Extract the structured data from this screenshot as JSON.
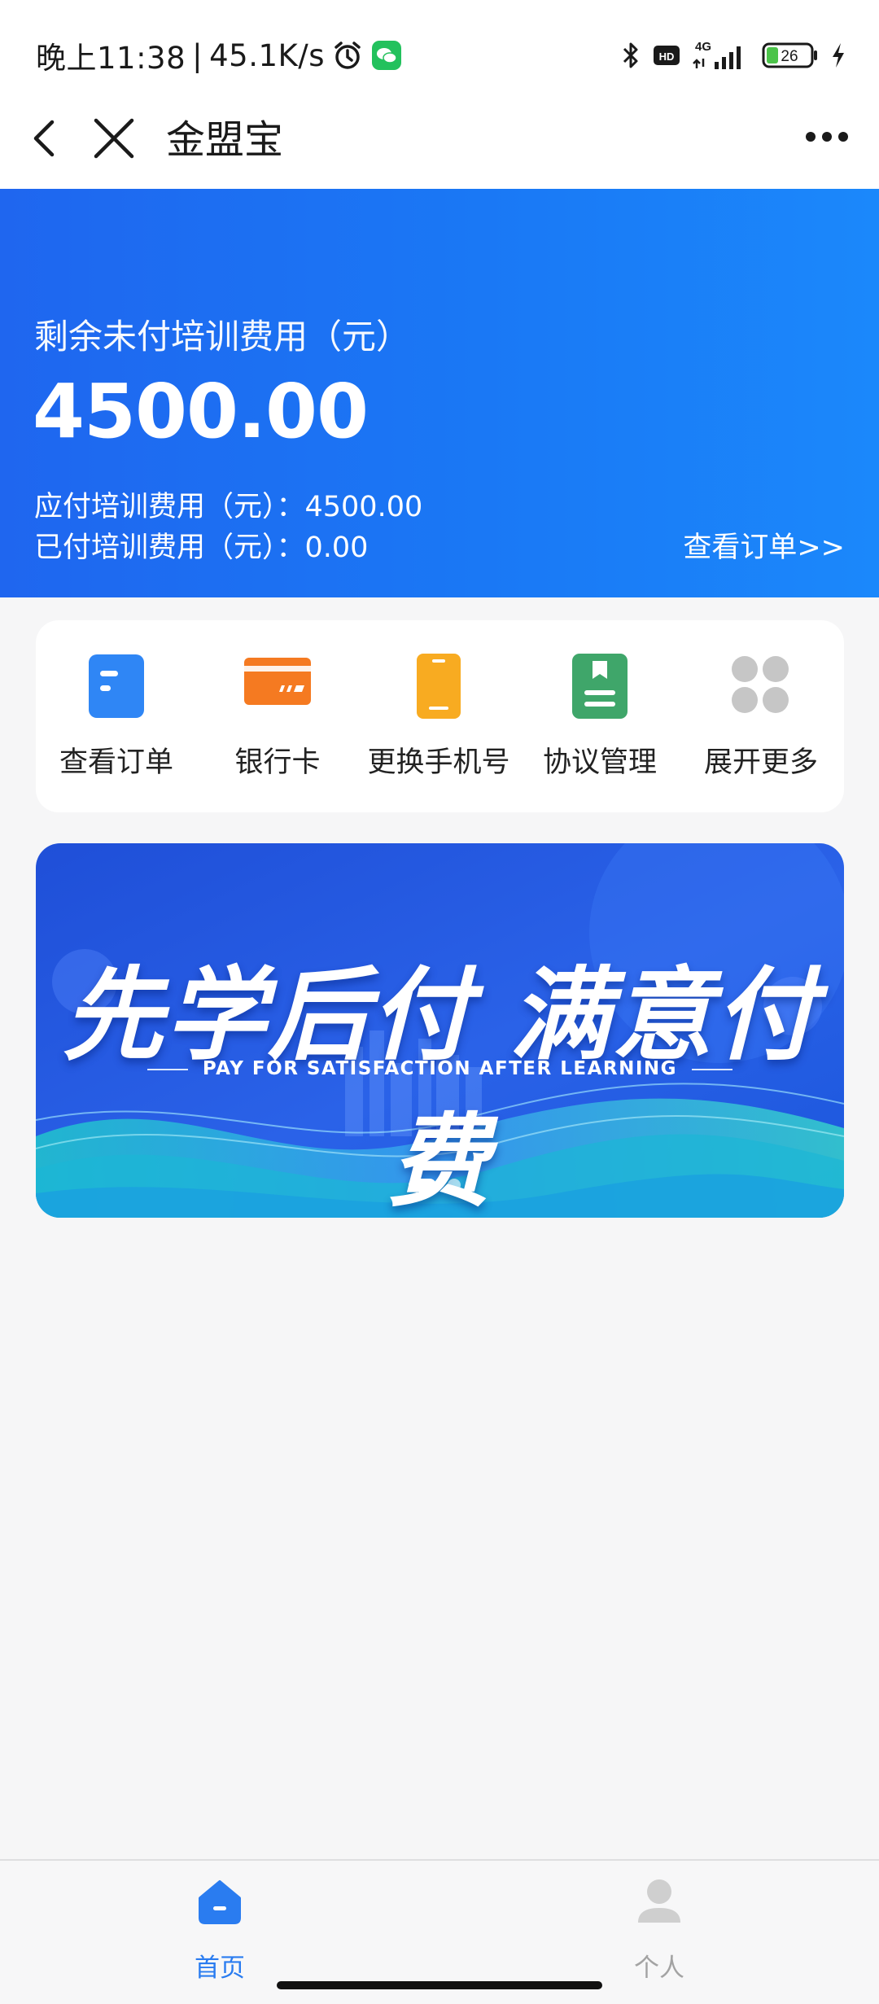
{
  "status_bar": {
    "time": "晚上11:38",
    "separator": "|",
    "net_speed": "45.1K/s",
    "network": "4G",
    "hd": "HD",
    "battery": "26"
  },
  "navbar": {
    "title": "金盟宝"
  },
  "summary": {
    "remaining_label": "剩余未付培训费用（元）",
    "remaining_amount": "4500.00",
    "payable_line": "应付培训费用（元）：4500.00",
    "paid_line": "已付培训费用（元）：0.00",
    "view_orders_link": "查看订单>>"
  },
  "quick_actions": [
    {
      "label": "查看订单",
      "icon": "order-icon",
      "color": "#2f86f5"
    },
    {
      "label": "银行卡",
      "icon": "bank-card-icon",
      "color": "#f57a21"
    },
    {
      "label": "更换手机号",
      "icon": "phone-icon",
      "color": "#f8ab21"
    },
    {
      "label": "协议管理",
      "icon": "agreement-icon",
      "color": "#3fa66a"
    },
    {
      "label": "展开更多",
      "icon": "more-grid-icon",
      "color": "#c6c6c6"
    }
  ],
  "banner": {
    "headline": "先学后付  满意付费",
    "subline": "PAY FOR SATISFACTION AFTER LEARNING",
    "slides_total": 2,
    "active_slide": 1
  },
  "tabbar": {
    "items": [
      {
        "label": "首页",
        "icon": "home-icon",
        "active": true
      },
      {
        "label": "个人",
        "icon": "person-icon",
        "active": false
      }
    ],
    "active_color": "#2a7cf0",
    "inactive_color": "#a3a3a3"
  },
  "colors": {
    "primary": "#1b73f2",
    "page_bg": "#f6f6f7"
  }
}
